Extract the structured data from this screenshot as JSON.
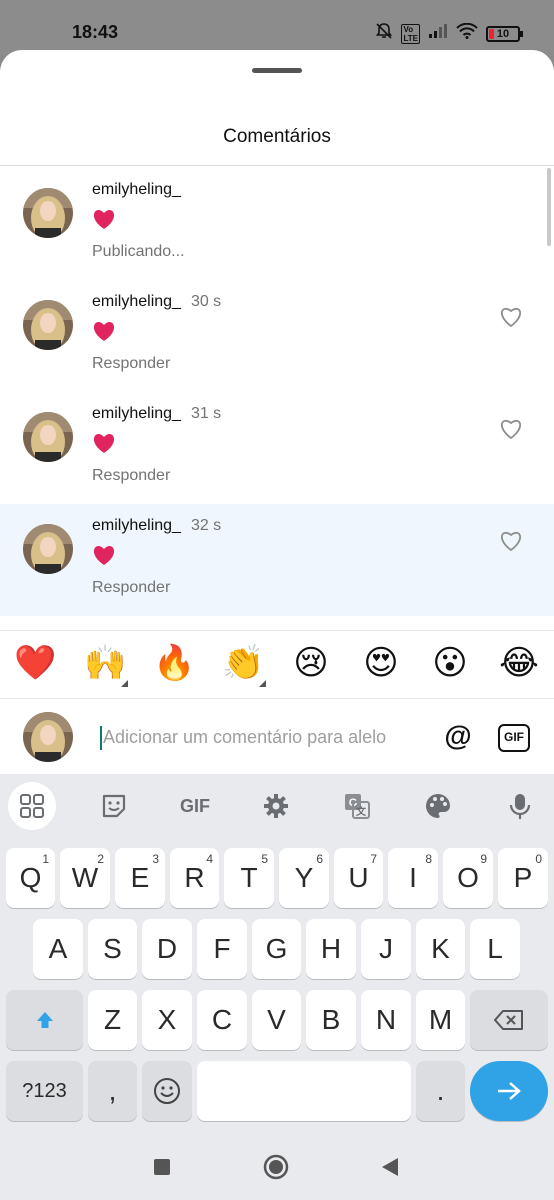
{
  "status_bar": {
    "time": "18:43",
    "battery_level": "10",
    "icons": [
      "bell-muted-icon",
      "volte-icon",
      "signal-icon",
      "wifi-icon",
      "battery-icon"
    ]
  },
  "sheet": {
    "title": "Comentários"
  },
  "comments": [
    {
      "username": "emilyheling_",
      "time": "",
      "text": "❤️",
      "action": "Publicando...",
      "liked": false,
      "show_like": false
    },
    {
      "username": "emilyheling_",
      "time": "30 s",
      "text": "❤️",
      "action": "Responder",
      "liked": false,
      "show_like": true
    },
    {
      "username": "emilyheling_",
      "time": "31 s",
      "text": "❤️",
      "action": "Responder",
      "liked": false,
      "show_like": true
    },
    {
      "username": "emilyheling_",
      "time": "32 s",
      "text": "❤️",
      "action": "Responder",
      "liked": false,
      "show_like": true
    }
  ],
  "quick_emojis": [
    "❤️",
    "🙌",
    "🔥",
    "👏",
    "😢",
    "😍",
    "😮",
    "😂"
  ],
  "comment_input": {
    "placeholder": "Adicionar um comentário para alelo",
    "value": "",
    "mention_label": "@",
    "gif_label": "GIF"
  },
  "keyboard": {
    "toolbar": [
      "apps-icon",
      "sticker-icon",
      "GIF",
      "settings-icon",
      "translate-icon",
      "theme-icon",
      "mic-icon"
    ],
    "toolbar_gif_label": "GIF",
    "row1": [
      {
        "key": "Q",
        "hint": "1"
      },
      {
        "key": "W",
        "hint": "2"
      },
      {
        "key": "E",
        "hint": "3"
      },
      {
        "key": "R",
        "hint": "4"
      },
      {
        "key": "T",
        "hint": "5"
      },
      {
        "key": "Y",
        "hint": "6"
      },
      {
        "key": "U",
        "hint": "7"
      },
      {
        "key": "I",
        "hint": "8"
      },
      {
        "key": "O",
        "hint": "9"
      },
      {
        "key": "P",
        "hint": "0"
      }
    ],
    "row2": [
      "A",
      "S",
      "D",
      "F",
      "G",
      "H",
      "J",
      "K",
      "L"
    ],
    "row3": [
      "Z",
      "X",
      "C",
      "V",
      "B",
      "N",
      "M"
    ],
    "symbols_label": "?123",
    "comma_label": ",",
    "period_label": "."
  },
  "nav_bar": [
    "recents-icon",
    "home-icon",
    "back-icon"
  ],
  "colors": {
    "accent": "#2fa3e6",
    "highlight_row": "#eff6fd",
    "heart": "#e0245e"
  }
}
